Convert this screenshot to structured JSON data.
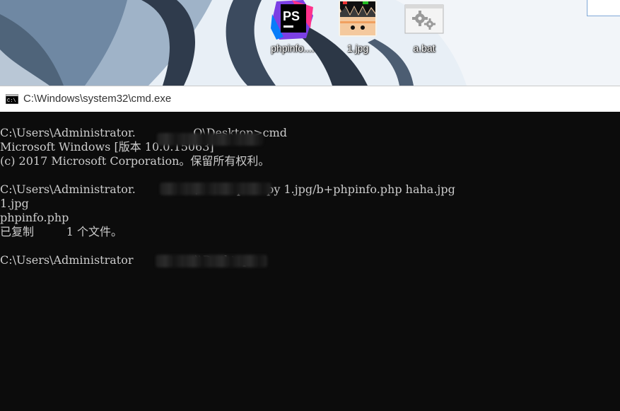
{
  "desktop": {
    "icons": [
      {
        "label": "phpinfo....",
        "icon": "phpstorm-icon",
        "badge": "PS"
      },
      {
        "label": "1.jpg",
        "icon": "jpg-image-icon"
      },
      {
        "label": "a.bat",
        "icon": "batch-file-gear-icon"
      }
    ]
  },
  "console_window": {
    "title": "C:\\Windows\\system32\\cmd.exe",
    "lines": [
      "C:\\Users\\Administrator.                Q\\Desktop>cmd",
      "Microsoft Windows [版本 10.0.15063]",
      "(c) 2017 Microsoft Corporation。保留所有权利。",
      "",
      "C:\\Users\\Administrator.                \\Desktop>copy 1.jpg/b+phpinfo.php haha.jpg",
      "1.jpg",
      "phpinfo.php",
      "已复制         1 个文件。",
      "",
      "C:\\Users\\Administrator                 )\\Desktop>"
    ]
  },
  "colors": {
    "console_bg": "#0c0c0c",
    "console_text": "#cccccc",
    "titlebar_bg": "#ffffff",
    "phpstorm_purple": "#7b3fe4"
  }
}
